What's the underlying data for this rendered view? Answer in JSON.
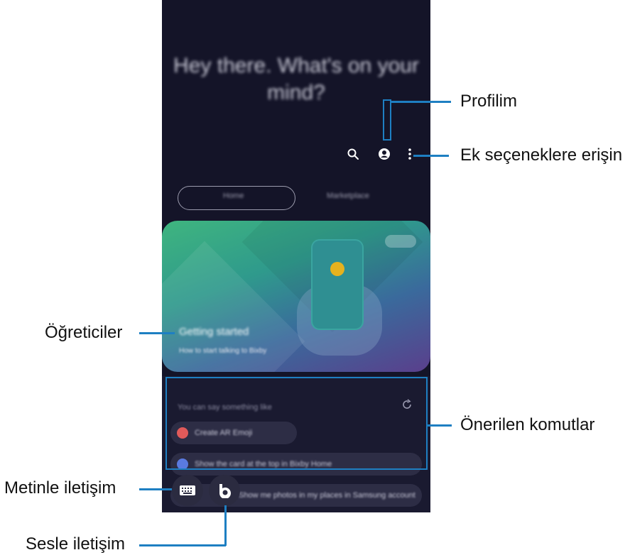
{
  "screen": {
    "greeting": "Hey there. What's on your mind?",
    "tabs": [
      "Home",
      "Marketplace"
    ],
    "banner": {
      "title": "Getting started",
      "subtitle": "How to start talking to Bixby"
    },
    "suggestions": {
      "hint": "You can say something like",
      "chips": [
        {
          "label": "Create AR Emoji",
          "icon": "emoji-icon",
          "color": "#e05a5a"
        },
        {
          "label": "Show the card at the top in Bixby Home",
          "icon": "bixby-icon",
          "color": "#5a7ae0"
        },
        {
          "label": "Show me photos in my places in Samsung account",
          "icon": "bixby-icon",
          "color": "#5a7ae0"
        }
      ]
    }
  },
  "callouts": {
    "profile": "Profilim",
    "more_options": "Ek seçeneklere erişin",
    "tutorials": "Öğreticiler",
    "suggested_commands": "Önerilen komutlar",
    "text_communication": "Metinle iletişim",
    "voice_communication": "Sesle iletişim"
  },
  "colors": {
    "screen_bg": "#141428",
    "callout_line": "#1e7fc2",
    "bixby_yellow": "#e6b21e"
  }
}
